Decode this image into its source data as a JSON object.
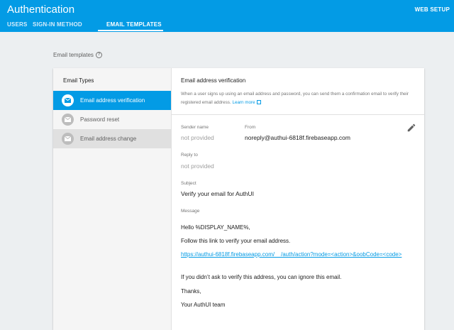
{
  "appbar": {
    "title": "Authentication",
    "web_setup": "WEB SETUP"
  },
  "tabs": [
    {
      "label": "USERS"
    },
    {
      "label": "SIGN-IN METHOD"
    },
    {
      "label": "EMAIL TEMPLATES",
      "active": true
    }
  ],
  "section": {
    "label": "Email templates",
    "help_icon": "help-circle-icon"
  },
  "email_types": {
    "title": "Email Types",
    "items": [
      {
        "label": "Email address verification",
        "icon": "mail-icon",
        "active": true
      },
      {
        "label": "Password reset",
        "icon": "mail-icon"
      },
      {
        "label": "Email address change",
        "icon": "mail-icon"
      }
    ]
  },
  "template": {
    "title": "Email address verification",
    "description": "When a user signs up using an email address and password, you can send them a confirmation email to verify their registered email address.",
    "learn_more": "Learn more",
    "sender_name_label": "Sender name",
    "sender_name_value": "not provided",
    "from_label": "From",
    "from_value": "noreply@authui-6818f.firebaseapp.com",
    "reply_to_label": "Reply to",
    "reply_to_value": "not provided",
    "subject_label": "Subject",
    "subject_value": "Verify your email for AuthUI",
    "message_label": "Message",
    "message": {
      "greeting": "Hello %DISPLAY_NAME%,",
      "line1": "Follow this link to verify your email address.",
      "link": "https://authui-6818f.firebaseapp.com/__/auth/action?mode=<action>&oobCode=<code>",
      "line2": "If you didn’t ask to verify this address, you can ignore this email.",
      "closing": "Thanks,",
      "signature": "Your AuthUI team"
    }
  },
  "colors": {
    "accent": "#039be5",
    "background": "#eceff1"
  }
}
